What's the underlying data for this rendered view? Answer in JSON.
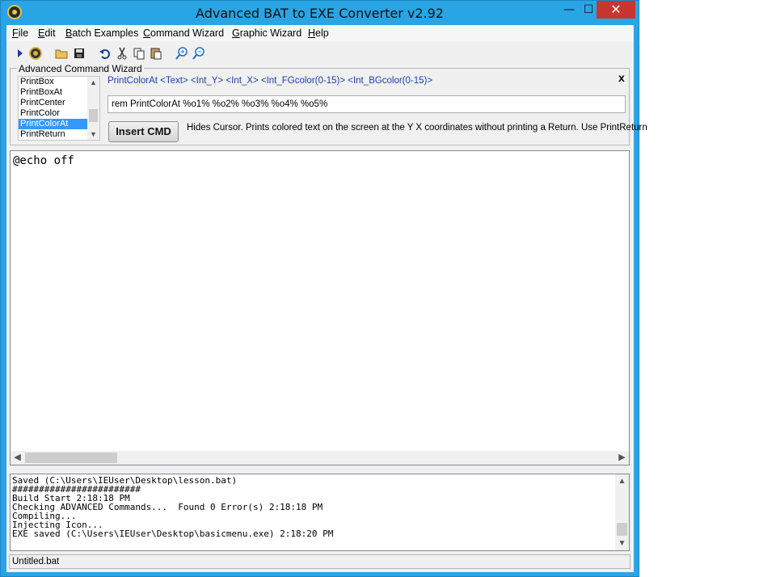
{
  "window": {
    "title": "Advanced BAT to EXE Converter v2.92",
    "controls": {
      "minimize": "—",
      "maximize": "☐",
      "close": "✕"
    }
  },
  "menu": {
    "items": [
      "File",
      "Edit",
      "Batch Examples",
      "Command Wizard",
      "Graphic Wizard",
      "Help"
    ]
  },
  "toolbar": {
    "icons": [
      "run-icon",
      "compile-icon",
      "open-folder-icon",
      "save-icon",
      "undo-icon",
      "cut-icon",
      "copy-icon",
      "paste-icon",
      "zoom-in-icon",
      "zoom-out-icon"
    ]
  },
  "wizard": {
    "legend": "Advanced Command Wizard",
    "close": "x",
    "commands": [
      "PrintBox",
      "PrintBoxAt",
      "PrintCenter",
      "PrintColor",
      "PrintColorAt",
      "PrintReturn"
    ],
    "selected_index": 4,
    "syntax": "PrintColorAt  <Text> <Int_Y> <Int_X> <Int_FGcolor(0-15)> <Int_BGcolor(0-15)>",
    "command_value": "rem PrintColorAt %o1% %o2% %o3% %o4% %o5%",
    "insert_button": "Insert CMD",
    "description": "Hides Cursor. Prints colored text on the screen at the Y X coordinates without printing a Return. Use PrintReturn"
  },
  "editor": {
    "content": "@echo off"
  },
  "log": {
    "lines": [
      "Saved (C:\\Users\\IEUser\\Desktop\\lesson.bat)",
      "########################",
      "Build Start 2:18:18 PM",
      "Checking ADVANCED Commands...  Found 0 Error(s) 2:18:18 PM",
      "Compiling...",
      "Injecting Icon...",
      "EXE saved (C:\\Users\\IEUser\\Desktop\\basicmenu.exe) 2:18:20 PM"
    ]
  },
  "status": {
    "filename": "Untitled.bat"
  },
  "colors": {
    "window_frame": "#29a4e4",
    "close_button": "#c7372f",
    "selection": "#3399ff",
    "syntax_text": "#1c3ea8"
  }
}
